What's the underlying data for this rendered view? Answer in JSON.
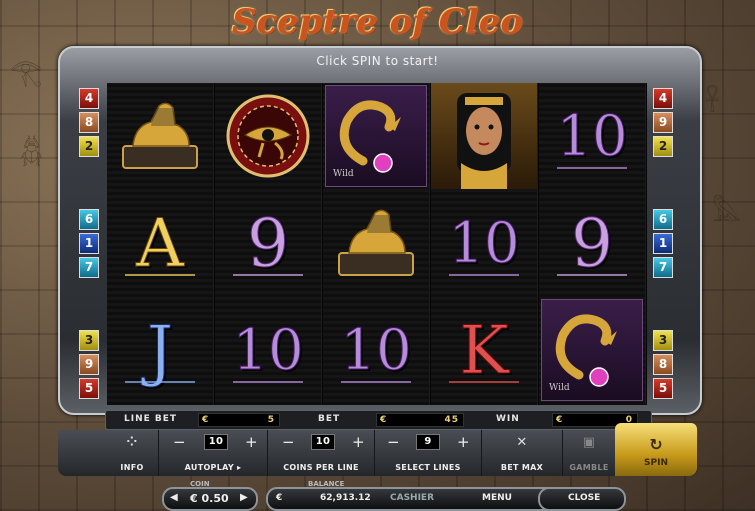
{
  "title": "Sceptre of Cleo",
  "status": "Click SPIN to start!",
  "left_paylines": [
    "4",
    "8",
    "2",
    "6",
    "1",
    "7",
    "3",
    "9",
    "5"
  ],
  "right_paylines": [
    "4",
    "9",
    "2",
    "6",
    "1",
    "7",
    "3",
    "8",
    "5"
  ],
  "reels": [
    [
      "sphinx-symbol",
      "A",
      "J"
    ],
    [
      "eye-of-horus-symbol",
      "9",
      "10"
    ],
    [
      "wild-sceptre-symbol",
      "sphinx-symbol",
      "10"
    ],
    [
      "cleopatra-symbol",
      "10",
      "K"
    ],
    [
      "10",
      "9",
      "wild-sceptre-symbol"
    ]
  ],
  "wild_label": "Wild",
  "betbar": {
    "line_bet_label": "LINE BET",
    "line_bet_currency": "€",
    "line_bet_value": "5",
    "bet_label": "BET",
    "bet_currency": "€",
    "bet_value": "45",
    "win_label": "WIN",
    "win_currency": "€",
    "win_value": "0"
  },
  "controls": {
    "info_label": "INFO",
    "autoplay_label": "AUTOPLAY ▸",
    "autoplay_value": "10",
    "coins_label": "COINS PER LINE",
    "coins_value": "10",
    "lines_label": "SELECT LINES",
    "lines_value": "9",
    "betmax_label": "BET MAX",
    "gamble_label": "GAMBLE",
    "spin_label": "SPIN",
    "minus": "−",
    "plus": "+"
  },
  "bottom": {
    "coin_label": "COIN",
    "coin_value": "€ 0.50",
    "balance_label": "BALANCE",
    "balance_currency": "€",
    "balance_value": "62,913.12",
    "cashier_label": "CASHIER",
    "menu_label": "MENU",
    "close_label": "CLOSE"
  },
  "colors": {
    "gold": "#e0b64a",
    "purple": "#7a3fb0",
    "spin_gold": "#e8c44a"
  }
}
